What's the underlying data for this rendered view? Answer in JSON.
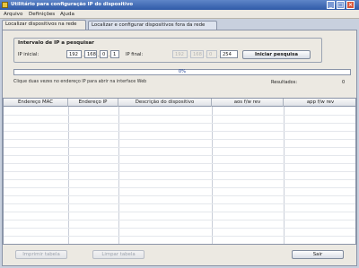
{
  "window": {
    "title": "Utilitário para configuração IP do dispositivo",
    "controls": {
      "minimize": "_",
      "maximize": "□",
      "close": "×"
    }
  },
  "menu": [
    "Arquivo",
    "Definições",
    "Ajuda"
  ],
  "tabs": [
    "Localizar dispositivos na rede",
    "Localizar e configurar dispositivos fora da rede"
  ],
  "search": {
    "group_title": "Intervalo de IP a pesquisar",
    "start_label": "IP inicial:",
    "start_ip": [
      "192",
      "168",
      "0",
      "1"
    ],
    "end_label": "IP final:",
    "end_ip": [
      "192",
      "168",
      "0",
      "254"
    ],
    "start_button": "Iniciar pesquisa"
  },
  "progress": {
    "text": "0%",
    "value": 0
  },
  "hint": "Clique duas vezes no endereço IP para abrir na interface Web",
  "results": {
    "label": "Resultados:",
    "count": "0"
  },
  "table": {
    "columns": [
      "Endereço MAC",
      "Endereço IP",
      "Descrição do dispositivo",
      "aos f/w rev",
      "app f/w rev"
    ],
    "rows": []
  },
  "buttons": {
    "print": "Imprimir tabela",
    "clear": "Limpar tabela",
    "exit": "Sair"
  }
}
